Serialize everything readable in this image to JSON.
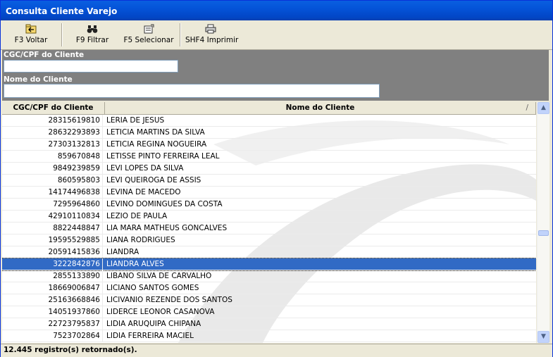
{
  "window": {
    "title": "Consulta Cliente Varejo"
  },
  "toolbar": {
    "buttons": [
      {
        "label": "F3 Voltar",
        "icon": "folder-back-icon"
      },
      {
        "label": "F9 Filtrar",
        "icon": "binoculars-icon"
      },
      {
        "label": "F5 Selecionar",
        "icon": "select-form-icon"
      },
      {
        "label": "SHF4 Imprimir",
        "icon": "printer-icon"
      }
    ]
  },
  "filter": {
    "cpf_label": "CGC/CPF do Cliente",
    "cpf_value": "",
    "name_label": "Nome do Cliente",
    "name_value": ""
  },
  "grid": {
    "columns": [
      "CGC/CPF do Cliente",
      "Nome do Cliente"
    ],
    "sort_indicator": "/",
    "selected_index": 12,
    "rows": [
      {
        "cpf": "28315619810",
        "name": "LERIA DE JESUS"
      },
      {
        "cpf": "28632293893",
        "name": "LETICIA MARTINS DA SILVA"
      },
      {
        "cpf": "27303132813",
        "name": "LETICIA REGINA NOGUEIRA"
      },
      {
        "cpf": "859670848",
        "name": "LETISSE PINTO FERREIRA LEAL"
      },
      {
        "cpf": "9849239859",
        "name": "LEVI LOPES DA SILVA"
      },
      {
        "cpf": "860595803",
        "name": "LEVI QUEIROGA DE ASSIS"
      },
      {
        "cpf": "14174496838",
        "name": "LEVINA DE MACEDO"
      },
      {
        "cpf": "7295964860",
        "name": "LEVINO DOMINGUES DA COSTA"
      },
      {
        "cpf": "42910110834",
        "name": "LEZIO DE PAULA"
      },
      {
        "cpf": "8822448847",
        "name": "LIA MARA MATHEUS GONCALVES"
      },
      {
        "cpf": "19595529885",
        "name": "LIANA RODRIGUES"
      },
      {
        "cpf": "20591415836",
        "name": "LIANDRA"
      },
      {
        "cpf": "3222842876",
        "name": "LIANDRA ALVES"
      },
      {
        "cpf": "2855133890",
        "name": "LIBANO SILVA DE CARVALHO"
      },
      {
        "cpf": "18669006847",
        "name": "LICIANO SANTOS GOMES"
      },
      {
        "cpf": "25163668846",
        "name": "LICIVANIO REZENDE DOS SANTOS"
      },
      {
        "cpf": "14051937860",
        "name": "LIDERCE LEONOR CASANOVA"
      },
      {
        "cpf": "22723795837",
        "name": "LIDIA ARUQUIPA CHIPANA"
      },
      {
        "cpf": "7523702864",
        "name": "LIDIA FERREIRA MACIEL"
      }
    ]
  },
  "scrollbar": {
    "up_icon": "scroll-up-icon",
    "down_icon": "scroll-down-icon",
    "position": 0.55
  },
  "status": {
    "text": "12.445 registro(s) retornado(s)."
  },
  "colors": {
    "title_bar": "#0453d8",
    "selection": "#316ac5",
    "filter_panel": "#808080"
  }
}
